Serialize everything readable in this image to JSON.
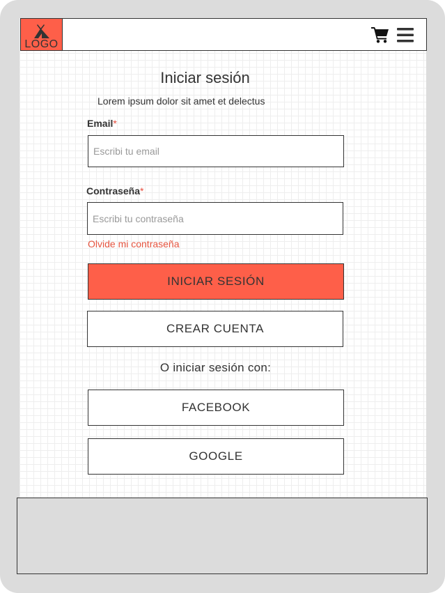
{
  "header": {
    "logo_text": "LOGO",
    "icons": [
      "tent-icon",
      "cart-icon",
      "hamburger-menu-icon"
    ]
  },
  "login": {
    "title": "Iniciar sesión",
    "subtitle": "Lorem ipsum dolor sit amet et delectus",
    "email_label": "Email",
    "email_placeholder": "Escribi tu email",
    "email_value": "",
    "password_label": "Contraseña",
    "password_placeholder": "Escribi tu contraseña",
    "password_value": "",
    "required_mark": "*",
    "forgot_label": "Olvide mi contraseña",
    "submit_label": "INICIAR SESIÓN",
    "create_account_label": "CREAR CUENTA",
    "or_label": "O iniciar sesión con:",
    "facebook_label": "FACEBOOK",
    "google_label": "GOOGLE"
  },
  "colors": {
    "accent": "#fe5f49",
    "link": "#e5543f",
    "text": "#333333",
    "frame": "#dcdcdc"
  }
}
